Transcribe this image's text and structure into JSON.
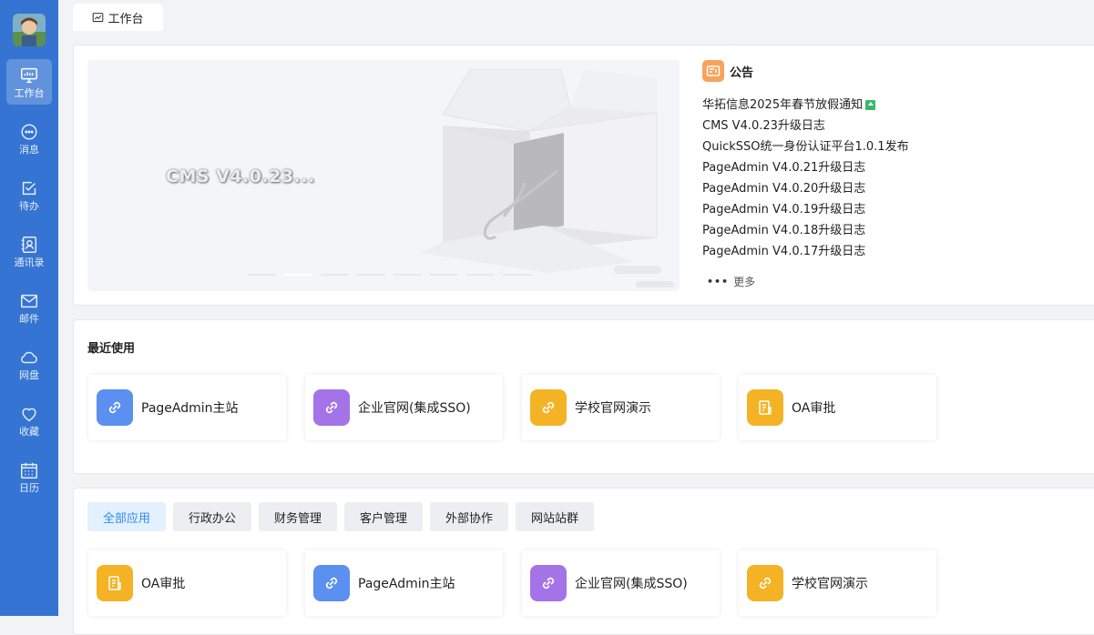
{
  "sidebar": {
    "items": [
      {
        "label": "工作台",
        "icon": "monitor-icon"
      },
      {
        "label": "消息",
        "icon": "chat-icon"
      },
      {
        "label": "待办",
        "icon": "checkbox-icon"
      },
      {
        "label": "通讯录",
        "icon": "contacts-icon"
      },
      {
        "label": "邮件",
        "icon": "mail-icon"
      },
      {
        "label": "网盘",
        "icon": "cloud-icon"
      },
      {
        "label": "收藏",
        "icon": "heart-icon"
      },
      {
        "label": "日历",
        "icon": "calendar-icon"
      }
    ]
  },
  "tabs": [
    {
      "label": "工作台"
    }
  ],
  "banner": {
    "text": "CMS V4.0.23..."
  },
  "notice": {
    "title": "公告",
    "items": [
      "华拓信息2025年春节放假通知",
      "CMS V4.0.23升级日志",
      "QuickSSO统一身份认证平台1.0.1发布",
      "PageAdmin V4.0.21升级日志",
      "PageAdmin V4.0.20升级日志",
      "PageAdmin V4.0.19升级日志",
      "PageAdmin V4.0.18升级日志",
      "PageAdmin V4.0.17升级日志"
    ],
    "more": "更多"
  },
  "recent": {
    "title": "最近使用",
    "apps": [
      {
        "label": "PageAdmin主站",
        "icon": "link-icon",
        "color": "#5b8ff0"
      },
      {
        "label": "企业官网(集成SSO)",
        "icon": "link-icon",
        "color": "#a473e8"
      },
      {
        "label": "学校官网演示",
        "icon": "link-icon",
        "color": "#f3b325"
      },
      {
        "label": "OA审批",
        "icon": "document-icon",
        "color": "#f3b325"
      }
    ]
  },
  "all_apps": {
    "filters": [
      "全部应用",
      "行政办公",
      "财务管理",
      "客户管理",
      "外部协作",
      "网站站群"
    ],
    "apps": [
      {
        "label": "OA审批",
        "icon": "document-icon",
        "color": "#f3b325"
      },
      {
        "label": "PageAdmin主站",
        "icon": "link-icon",
        "color": "#5b8ff0"
      },
      {
        "label": "企业官网(集成SSO)",
        "icon": "link-icon",
        "color": "#a473e8"
      },
      {
        "label": "学校官网演示",
        "icon": "link-icon",
        "color": "#f3b325"
      }
    ]
  },
  "colors": {
    "sidebar": "#3574d3",
    "accent": "#2f8ceb"
  }
}
